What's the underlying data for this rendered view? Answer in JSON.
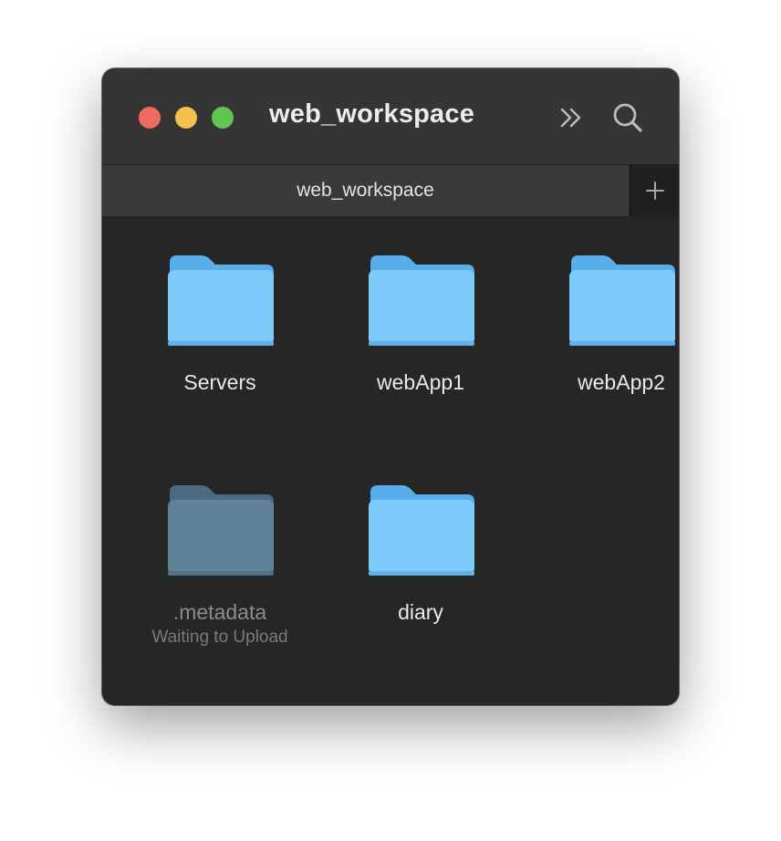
{
  "window": {
    "title": "web_workspace",
    "controls": {
      "close": "close-button",
      "minimize": "minimize-button",
      "zoom": "zoom-button"
    },
    "toolbar_icons": [
      "double-chevron-right-icon",
      "search-icon"
    ]
  },
  "tabs": {
    "items": [
      {
        "label": "web_workspace",
        "selected": true
      }
    ],
    "add_icon": "plus-icon"
  },
  "files": [
    {
      "name": "Servers",
      "kind": "folder",
      "status": ""
    },
    {
      "name": "webApp1",
      "kind": "folder",
      "status": ""
    },
    {
      "name": "webApp2",
      "kind": "folder",
      "status": ""
    },
    {
      "name": ".metadata",
      "kind": "folder",
      "status": "Waiting to Upload",
      "dimmed": true
    },
    {
      "name": "diary",
      "kind": "folder",
      "status": ""
    }
  ],
  "colors": {
    "close": "#ec6a5e",
    "minimize": "#f4bf4f",
    "zoom": "#61c554",
    "folder": "#7ccbfa",
    "folder_tab": "#58aeea",
    "folder_dimmed": "#5f8298",
    "window_bg": "#262626"
  }
}
